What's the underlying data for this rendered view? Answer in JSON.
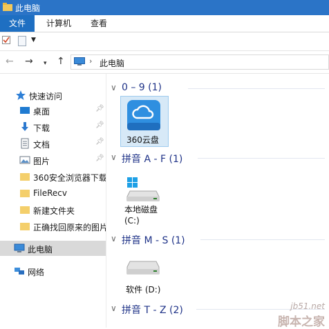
{
  "window": {
    "title": "此电脑"
  },
  "ribbon": {
    "tabs": [
      "文件",
      "计算机",
      "查看"
    ]
  },
  "address_bar": {
    "crumb": "此电脑",
    "separator": "›"
  },
  "nav_pane": {
    "quick_access": "快速访问",
    "items": [
      "桌面",
      "下载",
      "文档",
      "图片",
      "360安全浏览器下载",
      "FileRecv",
      "新建文件夹",
      "正确找回原来的图片"
    ],
    "this_pc": "此电脑",
    "network": "网络"
  },
  "groups": [
    {
      "title": "0 – 9 (1)",
      "items": [
        {
          "label": "360云盘",
          "icon": "cloud-drive-icon"
        }
      ]
    },
    {
      "title": "拼音 A - F (1)",
      "items": [
        {
          "label": "本地磁盘",
          "label2": "(C:)",
          "icon": "system-drive-icon"
        }
      ]
    },
    {
      "title": "拼音 M - S (1)",
      "items": [
        {
          "label": "软件 (D:)",
          "icon": "hard-drive-icon"
        }
      ]
    },
    {
      "title": "拼音 T - Z (2)",
      "items": []
    }
  ],
  "watermark": {
    "line1": "jb51.net",
    "line2": "脚本之家"
  },
  "colors": {
    "titlebar": "#2b74c7",
    "file_tab": "#1e6fc2",
    "group_header": "#1e3287",
    "selection": "#d7e9f7"
  }
}
